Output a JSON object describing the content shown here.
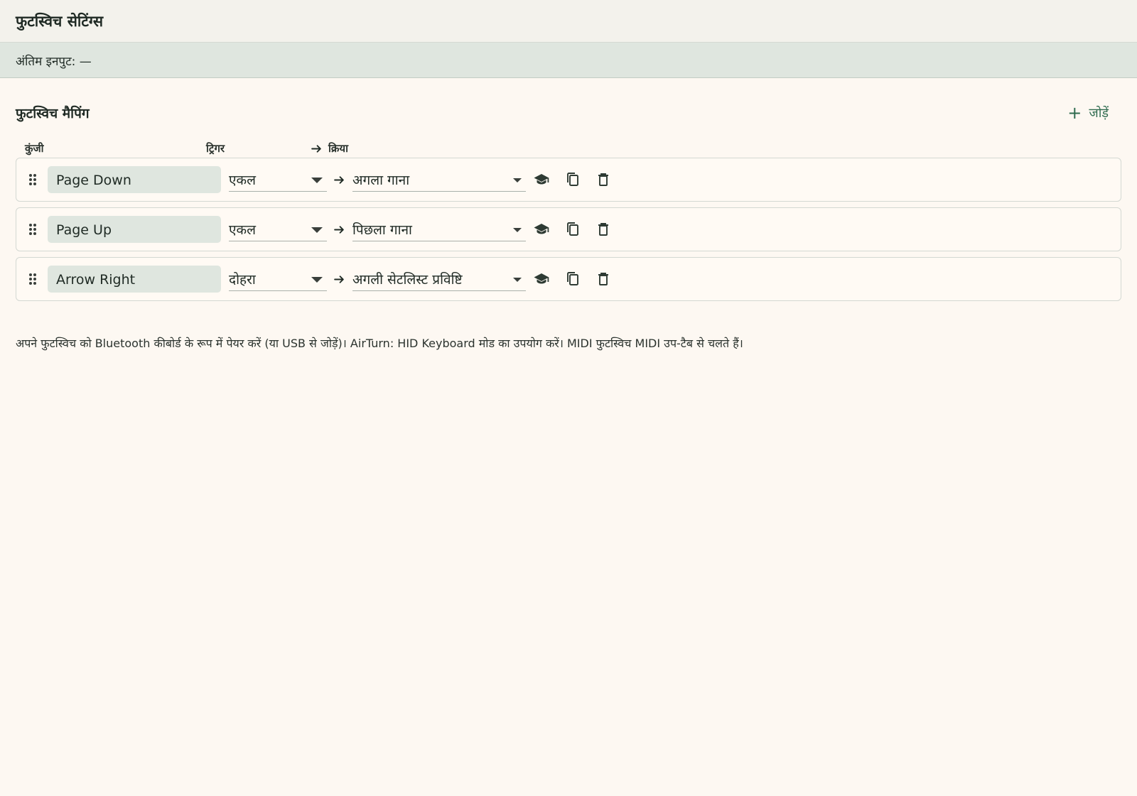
{
  "window": {
    "title": "फुटस्विच सेटिंग्स"
  },
  "status": {
    "last_input": "अंतिम इनपुट: —"
  },
  "mapping": {
    "title": "फुटस्विच मैपिंग",
    "add_label": "जोड़ें",
    "add_icon": "plus-icon",
    "columns": {
      "key": "कुंजी",
      "trigger": "ट्रिगर",
      "action": "क्रिया"
    },
    "rows": [
      {
        "key": "Page Down",
        "trigger": "एकल",
        "action": "अगला गाना"
      },
      {
        "key": "Page Up",
        "trigger": "एकल",
        "action": "पिछला गाना"
      },
      {
        "key": "Arrow Right",
        "trigger": "दोहरा",
        "action": "अगली सेटलिस्ट प्रविष्टि"
      }
    ],
    "row_icons": [
      "drag-handle-icon",
      "learn-icon",
      "copy-icon",
      "delete-icon"
    ]
  },
  "help": {
    "text": "अपने फुटस्विच को Bluetooth कीबोर्ड के रूप में पेयर करें (या USB से जोड़ें)। AirTurn: HID Keyboard मोड का उपयोग करें। MIDI फुटस्विच MIDI उप-टैब से चलते हैं।"
  },
  "colors": {
    "accent": "#2e6b4f",
    "background": "#fdf8f2",
    "status_bar": "#dfe6df",
    "title_bar": "#f3f2ec"
  }
}
